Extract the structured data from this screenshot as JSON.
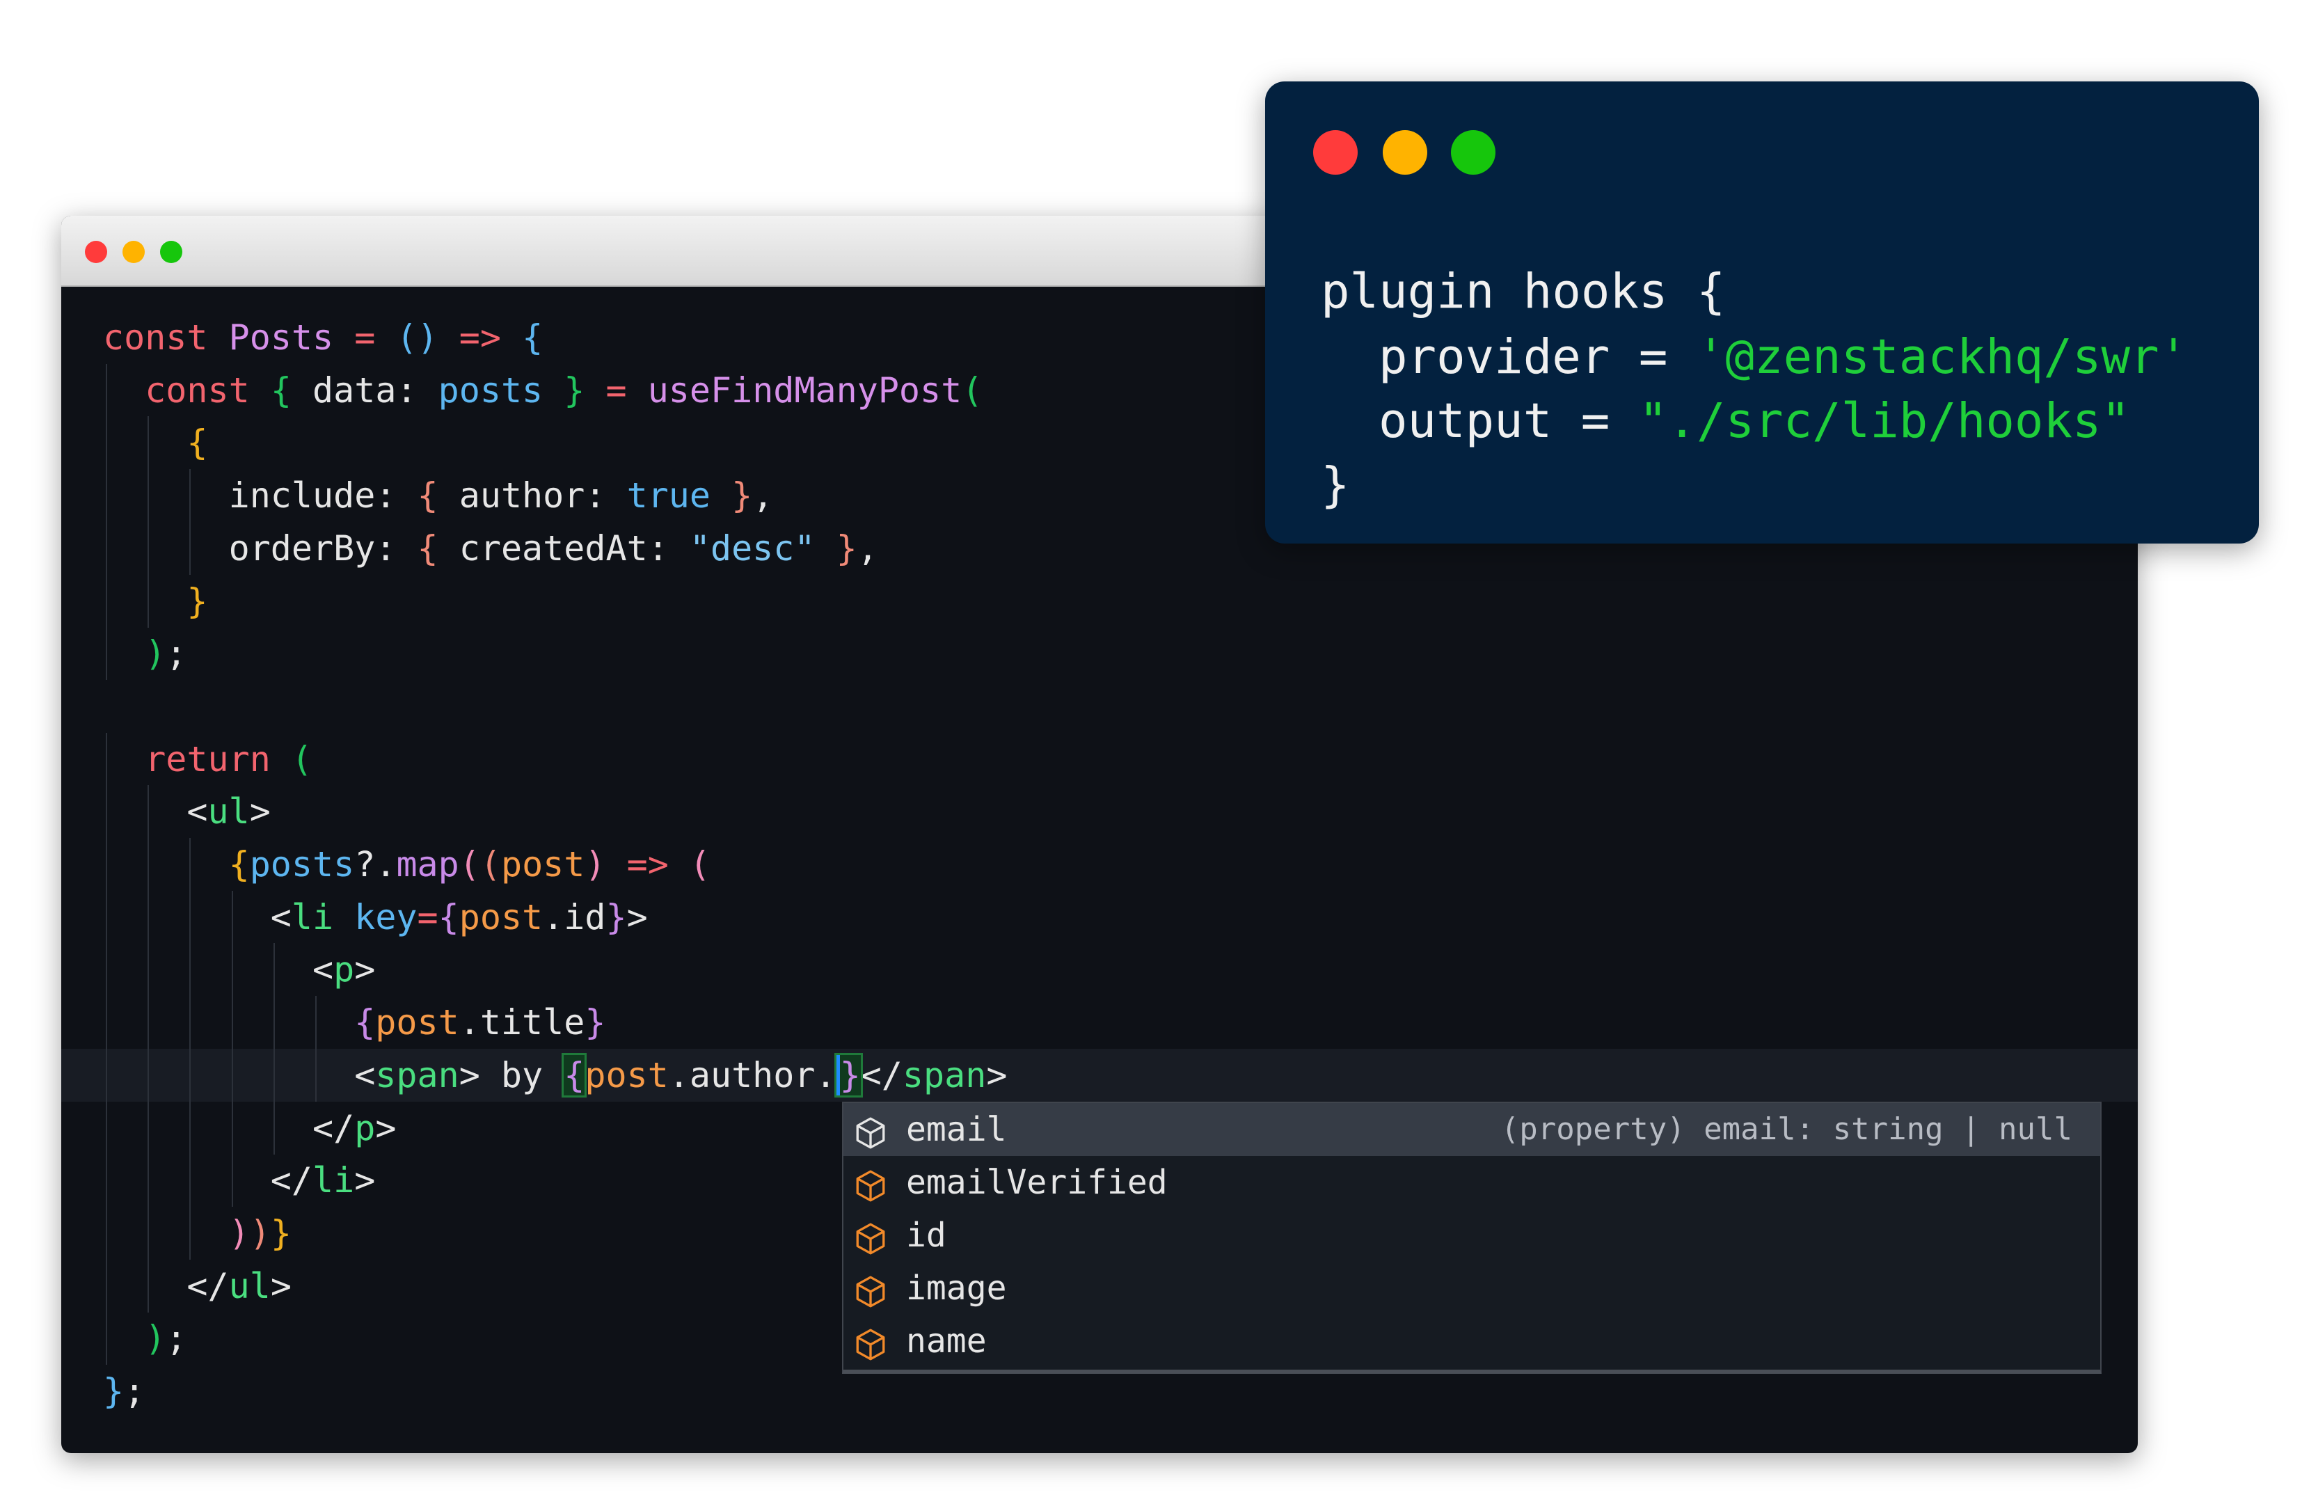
{
  "editor": {
    "window_controls": {
      "close_color": "#ff3b3b",
      "minimize_color": "#ffb300",
      "maximize_color": "#16c60c"
    },
    "current_line": 14,
    "lines": [
      {
        "indent": 0,
        "tokens": [
          [
            "const ",
            "kw"
          ],
          [
            "Posts",
            "fn"
          ],
          [
            " = ",
            "kw"
          ],
          [
            "()",
            "var"
          ],
          [
            " => ",
            "kw"
          ],
          [
            "{",
            "var"
          ]
        ]
      },
      {
        "indent": 2,
        "tokens": [
          [
            "const ",
            "kw"
          ],
          [
            "{",
            "g"
          ],
          [
            " data: ",
            "w"
          ],
          [
            "posts",
            "var"
          ],
          [
            " }",
            "g"
          ],
          [
            " = ",
            "kw"
          ],
          [
            "useFindManyPost",
            "fn"
          ],
          [
            "(",
            "g"
          ]
        ]
      },
      {
        "indent": 4,
        "tokens": [
          [
            "{",
            "y"
          ]
        ]
      },
      {
        "indent": 6,
        "tokens": [
          [
            "include: ",
            "w"
          ],
          [
            "{",
            "s"
          ],
          [
            " author: ",
            "w"
          ],
          [
            "true",
            "var"
          ],
          [
            " }",
            "s"
          ],
          [
            ",",
            "w"
          ]
        ]
      },
      {
        "indent": 6,
        "tokens": [
          [
            "orderBy: ",
            "w"
          ],
          [
            "{",
            "s"
          ],
          [
            " createdAt: ",
            "w"
          ],
          [
            "\"desc\"",
            "str"
          ],
          [
            " }",
            "s"
          ],
          [
            ",",
            "w"
          ]
        ]
      },
      {
        "indent": 4,
        "tokens": [
          [
            "}",
            "y"
          ]
        ]
      },
      {
        "indent": 2,
        "tokens": [
          [
            ")",
            "g"
          ],
          [
            ";",
            "w"
          ]
        ]
      },
      {
        "indent": 0,
        "tokens": []
      },
      {
        "indent": 2,
        "tokens": [
          [
            "return ",
            "kw"
          ],
          [
            "(",
            "g"
          ]
        ]
      },
      {
        "indent": 4,
        "tokens": [
          [
            "<",
            "w"
          ],
          [
            "ul",
            "tag"
          ],
          [
            ">",
            "w"
          ]
        ]
      },
      {
        "indent": 6,
        "tokens": [
          [
            "{",
            "y"
          ],
          [
            "posts",
            "var"
          ],
          [
            "?.",
            "w"
          ],
          [
            "map",
            "pu"
          ],
          [
            "(",
            "p"
          ],
          [
            "(",
            "s"
          ],
          [
            "post",
            "o"
          ],
          [
            ")",
            "p"
          ],
          [
            " => ",
            "kw"
          ],
          [
            "(",
            "p"
          ]
        ]
      },
      {
        "indent": 8,
        "tokens": [
          [
            "<",
            "w"
          ],
          [
            "li ",
            "tag"
          ],
          [
            "key",
            "var"
          ],
          [
            "=",
            "kw"
          ],
          [
            "{",
            "pu"
          ],
          [
            "post",
            "o"
          ],
          [
            ".id",
            "w"
          ],
          [
            "}",
            "pu"
          ],
          [
            ">",
            "w"
          ]
        ]
      },
      {
        "indent": 10,
        "tokens": [
          [
            "<",
            "w"
          ],
          [
            "p",
            "tag"
          ],
          [
            ">",
            "w"
          ]
        ]
      },
      {
        "indent": 12,
        "tokens": [
          [
            "{",
            "pu"
          ],
          [
            "post",
            "o"
          ],
          [
            ".title",
            "w"
          ],
          [
            "}",
            "pu"
          ]
        ]
      },
      {
        "indent": 12,
        "tokens": [
          [
            "<",
            "w"
          ],
          [
            "span",
            "tag"
          ],
          [
            "> by ",
            "w"
          ],
          [
            "{",
            "pu match"
          ],
          [
            "post",
            "o"
          ],
          [
            ".author.",
            "w"
          ],
          [
            "}",
            "pu match cursor"
          ],
          [
            "</",
            "w"
          ],
          [
            "span",
            "tag"
          ],
          [
            ">",
            "w"
          ]
        ]
      },
      {
        "indent": 10,
        "tokens": [
          [
            "</",
            "w"
          ],
          [
            "p",
            "tag"
          ],
          [
            ">",
            "w"
          ]
        ]
      },
      {
        "indent": 8,
        "tokens": [
          [
            "</",
            "w"
          ],
          [
            "li",
            "tag"
          ],
          [
            ">",
            "w"
          ]
        ]
      },
      {
        "indent": 6,
        "tokens": [
          [
            ")",
            "p"
          ],
          [
            ")",
            "s"
          ],
          [
            "}",
            "y"
          ]
        ]
      },
      {
        "indent": 4,
        "tokens": [
          [
            "</",
            "w"
          ],
          [
            "ul",
            "tag"
          ],
          [
            ">",
            "w"
          ]
        ]
      },
      {
        "indent": 2,
        "tokens": [
          [
            ")",
            "g"
          ],
          [
            ";",
            "w"
          ]
        ]
      },
      {
        "indent": 0,
        "tokens": [
          [
            "}",
            "var"
          ],
          [
            ";",
            "w"
          ]
        ]
      }
    ]
  },
  "autocomplete": {
    "items": [
      {
        "label": "email",
        "icon": "property-cube-icon",
        "detail": "(property) email: string | null",
        "selected": true
      },
      {
        "label": "emailVerified",
        "icon": "property-cube-icon"
      },
      {
        "label": "id",
        "icon": "property-cube-icon"
      },
      {
        "label": "image",
        "icon": "property-cube-icon"
      },
      {
        "label": "name",
        "icon": "property-cube-icon"
      }
    ],
    "icon_color": "#f28a2a",
    "selected_icon_color": "#e6e6e6"
  },
  "overlay": {
    "window_controls": {
      "close_color": "#ff3b3b",
      "minimize_color": "#ffb300",
      "maximize_color": "#16c60c"
    },
    "line1": "plugin hooks {",
    "line2_key": "provider = ",
    "line2_value": "'@zenstackhq/swr'",
    "line3_key": "output = ",
    "line3_value": "\"./src/lib/hooks\"",
    "line4": "}",
    "string_color": "#1fcf3a"
  }
}
